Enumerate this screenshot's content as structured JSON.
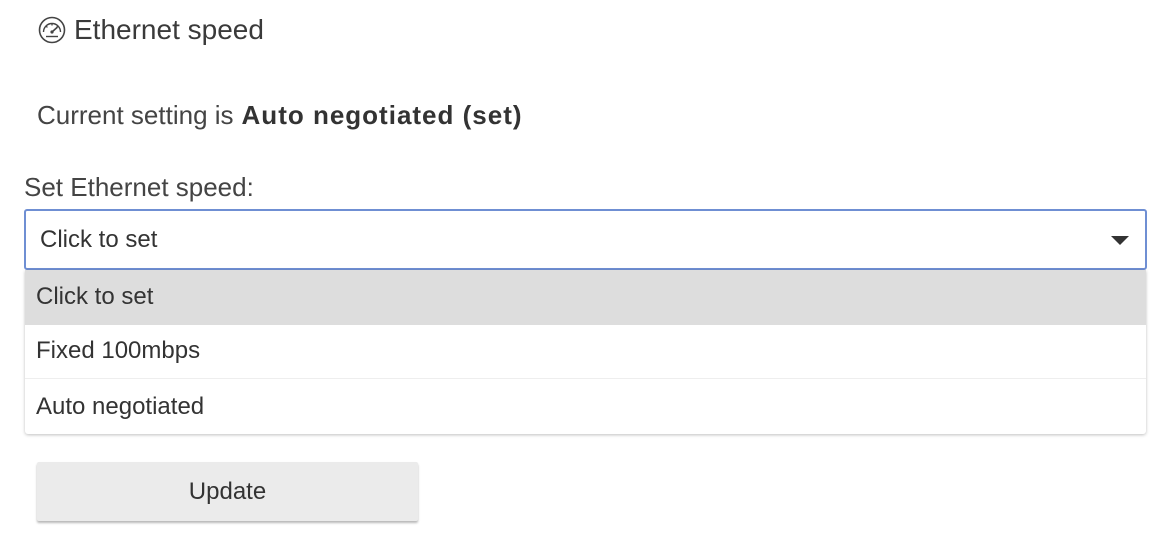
{
  "header": {
    "icon": "speedometer-icon",
    "title": "Ethernet speed"
  },
  "current_setting": {
    "prefix": "Current setting is",
    "value": "Auto negotiated (set)"
  },
  "speed_select": {
    "label": "Set Ethernet speed:",
    "selected": "Click to set",
    "icon": "caret-down-icon",
    "options": [
      {
        "label": "Click to set",
        "highlighted": true
      },
      {
        "label": "Fixed 100mbps",
        "highlighted": false
      },
      {
        "label": "Auto negotiated",
        "highlighted": false
      }
    ]
  },
  "actions": {
    "update_label": "Update"
  },
  "colors": {
    "select_border": "#6f8fd3",
    "highlight_bg": "#dddddd",
    "button_bg": "#ebebeb",
    "text": "#333333"
  }
}
